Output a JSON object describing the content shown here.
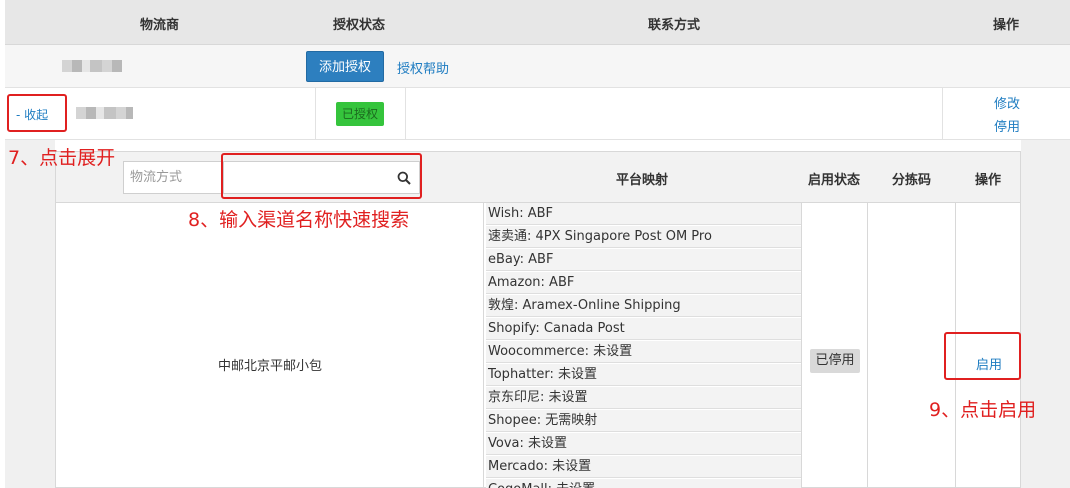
{
  "outer_header": {
    "carrier": "物流商",
    "auth_status": "授权状态",
    "contact": "联系方式",
    "actions": "操作"
  },
  "row1": {
    "add_auth_button": "添加授权",
    "auth_help_link": "授权帮助"
  },
  "row2": {
    "collapse_link": "- 收起",
    "status_badge": "已授权",
    "edit_link": "修改",
    "disable_link": "停用"
  },
  "annotations": {
    "step7": "7、点击展开",
    "step8": "8、输入渠道名称快速搜索",
    "step9": "9、点击启用"
  },
  "inner_header": {
    "search_placeholder": "物流方式",
    "search_value": "",
    "platform_mapping": "平台映射",
    "enable_status": "启用状态",
    "sort_code": "分拣码",
    "actions": "操作"
  },
  "channel": {
    "name": "中邮北京平邮小包",
    "status_badge": "已停用",
    "enable_link": "启用"
  },
  "mappings": [
    "Wish:  ABF",
    "速卖通:  4PX Singapore Post OM Pro",
    "eBay:  ABF",
    "Amazon:  ABF",
    "敦煌:  Aramex-Online Shipping",
    "Shopify:  Canada Post",
    "Woocommerce:  未设置",
    "Tophatter:  未设置",
    "京东印尼:  未设置",
    "Shopee:  无需映射",
    "Vova:  未设置",
    "Mercado:  未设置",
    "CogoMall:  未设置"
  ],
  "colors": {
    "primary_button": "#2d7fbf",
    "link": "#1e7cc1",
    "authorized_green": "#35c43c",
    "annotation_red": "#e02020"
  }
}
